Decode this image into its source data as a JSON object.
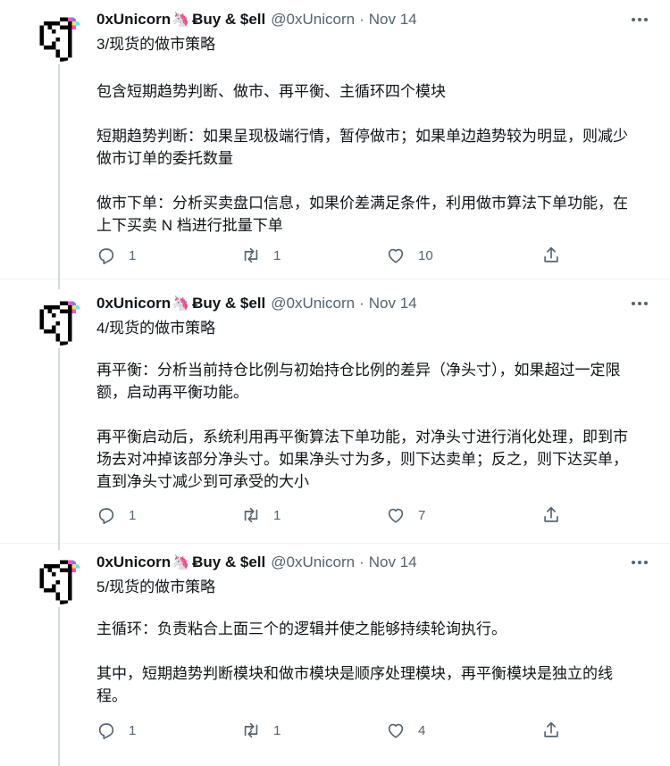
{
  "author": {
    "name": "0xUnicorn",
    "emoji": "🦄",
    "name_suffix": "Ƀuy & $ell",
    "handle": "@0xUnicorn",
    "separator": "·"
  },
  "icons": {
    "more": "more-horizontal-icon",
    "reply": "reply-icon",
    "retweet": "retweet-icon",
    "like": "heart-icon",
    "share": "share-icon"
  },
  "tweets": [
    {
      "time": "Nov 14",
      "title": "3/现货的做市策略",
      "paragraphs": [
        "包含短期趋势判断、做市、再平衡、主循环四个模块",
        "短期趋势判断：如果呈现极端行情，暂停做市；如果单边趋势较为明显，则减少做市订单的委托数量",
        "做市下单：分析买卖盘口信息，如果价差满足条件，利用做市算法下单功能，在上下买卖 N 档进行批量下单"
      ],
      "replies": "1",
      "retweets": "1",
      "likes": "10"
    },
    {
      "time": "Nov 14",
      "title": "4/现货的做市策略",
      "paragraphs": [
        "再平衡：分析当前持仓比例与初始持仓比例的差异（净头寸），如果超过一定限额，启动再平衡功能。",
        "再平衡启动后，系统利用再平衡算法下单功能，对净头寸进行消化处理，即到市场去对冲掉该部分净头寸。如果净头寸为多，则下达卖单；反之，则下达买单，直到净头寸减少到可承受的大小"
      ],
      "replies": "1",
      "retweets": "1",
      "likes": "7"
    },
    {
      "time": "Nov 14",
      "title": "5/现货的做市策略",
      "paragraphs": [
        "主循环：负责粘合上面三个的逻辑并使之能够持续轮询执行。",
        "其中，短期趋势判断模块和做市模块是顺序处理模块，再平衡模块是独立的线程。"
      ],
      "replies": "1",
      "retweets": "1",
      "likes": "4"
    }
  ]
}
